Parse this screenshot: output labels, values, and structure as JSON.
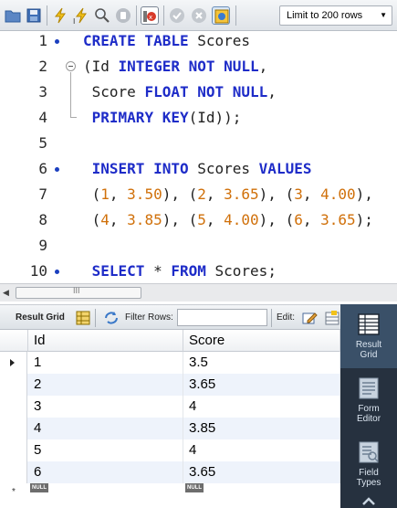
{
  "toolbar": {
    "icons": [
      "folder-icon",
      "save-icon",
      "execute-icon",
      "execute-current-icon",
      "explain-icon",
      "stop-icon",
      "toggle-continue-icon",
      "commit-icon",
      "rollback-icon",
      "autocommit-icon"
    ],
    "limit_select": "Limit to 200 rows"
  },
  "editor": {
    "lines": [
      {
        "n": "1",
        "tokens": [
          {
            "t": "CREATE TABLE ",
            "c": "kw"
          },
          {
            "t": "Scores",
            "c": "pl"
          }
        ]
      },
      {
        "n": "2",
        "tokens": [
          {
            "t": "(Id ",
            "c": "pl"
          },
          {
            "t": "INTEGER NOT NULL",
            "c": "kw"
          },
          {
            "t": ",",
            "c": "pl"
          }
        ]
      },
      {
        "n": "3",
        "tokens": [
          {
            "t": " Score ",
            "c": "pl"
          },
          {
            "t": "FLOAT NOT NULL",
            "c": "kw"
          },
          {
            "t": ",",
            "c": "pl"
          }
        ]
      },
      {
        "n": "4",
        "tokens": [
          {
            "t": " ",
            "c": "pl"
          },
          {
            "t": "PRIMARY KEY",
            "c": "kw"
          },
          {
            "t": "(Id));",
            "c": "pl"
          }
        ]
      },
      {
        "n": "5",
        "tokens": []
      },
      {
        "n": "6",
        "tokens": [
          {
            "t": " ",
            "c": "pl"
          },
          {
            "t": "INSERT INTO ",
            "c": "kw"
          },
          {
            "t": "Scores ",
            "c": "pl"
          },
          {
            "t": "VALUES",
            "c": "kw"
          }
        ]
      },
      {
        "n": "7",
        "tokens": [
          {
            "t": " (",
            "c": "pl"
          },
          {
            "t": "1",
            "c": "num"
          },
          {
            "t": ", ",
            "c": "pl"
          },
          {
            "t": "3.50",
            "c": "num"
          },
          {
            "t": "), (",
            "c": "pl"
          },
          {
            "t": "2",
            "c": "num"
          },
          {
            "t": ", ",
            "c": "pl"
          },
          {
            "t": "3.65",
            "c": "num"
          },
          {
            "t": "), (",
            "c": "pl"
          },
          {
            "t": "3",
            "c": "num"
          },
          {
            "t": ", ",
            "c": "pl"
          },
          {
            "t": "4.00",
            "c": "num"
          },
          {
            "t": "),",
            "c": "pl"
          }
        ]
      },
      {
        "n": "8",
        "tokens": [
          {
            "t": " (",
            "c": "pl"
          },
          {
            "t": "4",
            "c": "num"
          },
          {
            "t": ", ",
            "c": "pl"
          },
          {
            "t": "3.85",
            "c": "num"
          },
          {
            "t": "), (",
            "c": "pl"
          },
          {
            "t": "5",
            "c": "num"
          },
          {
            "t": ", ",
            "c": "pl"
          },
          {
            "t": "4.00",
            "c": "num"
          },
          {
            "t": "), (",
            "c": "pl"
          },
          {
            "t": "6",
            "c": "num"
          },
          {
            "t": ", ",
            "c": "pl"
          },
          {
            "t": "3.65",
            "c": "num"
          },
          {
            "t": ");",
            "c": "pl"
          }
        ]
      },
      {
        "n": "9",
        "tokens": []
      },
      {
        "n": "10",
        "tokens": [
          {
            "t": " ",
            "c": "pl"
          },
          {
            "t": "SELECT ",
            "c": "kw"
          },
          {
            "t": "* ",
            "c": "pl"
          },
          {
            "t": "FROM ",
            "c": "kw"
          },
          {
            "t": "Scores;",
            "c": "pl"
          }
        ]
      }
    ],
    "statement_markers": [
      "1",
      "6",
      "10"
    ],
    "scrollbar_thumb_glyph": "III"
  },
  "result_toolbar": {
    "result_grid_label": "Result Grid",
    "filter_label": "Filter Rows:",
    "filter_value": "",
    "edit_label": "Edit:"
  },
  "grid": {
    "columns": [
      "Id",
      "Score"
    ],
    "rows": [
      [
        "1",
        "3.5"
      ],
      [
        "2",
        "3.65"
      ],
      [
        "3",
        "4"
      ],
      [
        "4",
        "3.85"
      ],
      [
        "5",
        "4"
      ],
      [
        "6",
        "3.65"
      ]
    ],
    "null_badge": "NULL",
    "new_row_marker": "*"
  },
  "side_panel": {
    "buttons": [
      {
        "label": [
          "Result",
          "Grid"
        ],
        "icon": "result-grid-icon",
        "active": true
      },
      {
        "label": [
          "Form",
          "Editor"
        ],
        "icon": "form-editor-icon",
        "active": false
      },
      {
        "label": [
          "Field",
          "Types"
        ],
        "icon": "field-types-icon",
        "active": false
      }
    ]
  },
  "colors": {
    "keyword": "#1e2cc8",
    "number": "#d0700a",
    "side_panel_bg": "#26313f",
    "row_alt": "#eef3fb"
  }
}
